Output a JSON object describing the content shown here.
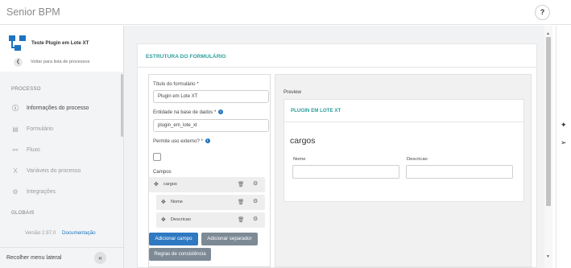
{
  "app": {
    "title": "Senior BPM",
    "help_icon": "?"
  },
  "sidebar": {
    "process_name": "Teste Plugin em Lote XT",
    "back_label": "Voltar para lista de processos",
    "section_process": "PROCESSO",
    "items": [
      {
        "label": "Informações do processo",
        "icon": "info-circle-icon",
        "glyph": "ⓘ",
        "active": true
      },
      {
        "label": "Formulário",
        "icon": "form-icon",
        "glyph": "▤",
        "active": false
      },
      {
        "label": "Fluxo",
        "icon": "flow-icon",
        "glyph": "⚯",
        "active": false
      },
      {
        "label": "Variáveis do processo",
        "icon": "variable-icon",
        "glyph": "X",
        "active": false
      },
      {
        "label": "Integrações",
        "icon": "integrations-icon",
        "glyph": "⚙",
        "active": false
      }
    ],
    "section_global": "GLOBAIS",
    "version": "Versão 2.97.0",
    "docs_link": "Documentação",
    "collapse_label": "Recolher menu lateral",
    "collapse_icon": "«"
  },
  "form": {
    "section_title": "ESTRUTURA DO FORMULÁRIO",
    "title_label": "Título do formulário",
    "title_value": "Plugin em Lote XT",
    "entity_label": "Entidade na base de dados",
    "entity_value": "plugin_em_lote_xt",
    "external_label": "Permite uso externo?",
    "external_checked": false,
    "fields_label": "Campos",
    "fields": [
      {
        "name": "cargos",
        "level": 0
      },
      {
        "name": "Nome",
        "level": 1
      },
      {
        "name": "Descricao",
        "level": 1
      }
    ],
    "add_field_button": "Adicionar campo",
    "add_separator_button": "Adicionar separador",
    "rules_button": "Regras de consistência"
  },
  "preview": {
    "label": "Preview",
    "form_title": "PLUGIN EM LOTE XT",
    "group_heading": "cargos",
    "columns": [
      "Nome",
      "Descricao"
    ]
  },
  "colors": {
    "accent": "#1e73be",
    "teal": "#2a9d9d",
    "button_blue": "#2f78c2",
    "button_gray": "#7d8a96"
  }
}
